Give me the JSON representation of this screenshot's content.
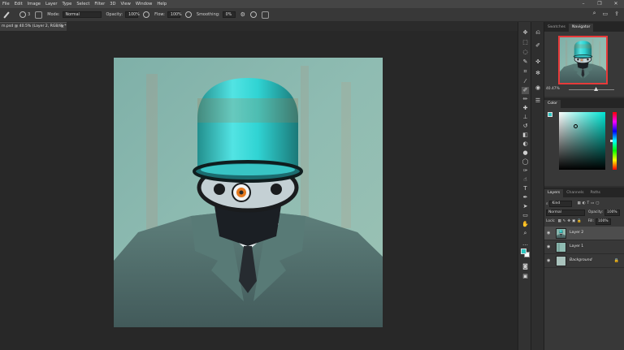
{
  "menu": [
    "File",
    "Edit",
    "Image",
    "Layer",
    "Type",
    "Select",
    "Filter",
    "3D",
    "View",
    "Window",
    "Help"
  ],
  "window_controls": [
    "–",
    "❐",
    "✕"
  ],
  "options": {
    "brush_size": "3",
    "mode_label": "Mode:",
    "mode_value": "Normal",
    "opacity_label": "Opacity:",
    "opacity_value": "100%",
    "flow_label": "Flow:",
    "flow_value": "100%",
    "smoothing_label": "Smoothing:",
    "smoothing_value": "0%"
  },
  "document_tab": {
    "title": "m.psd @ 40.5% (Layer 2, RGB/8) *",
    "close": "×"
  },
  "navigator": {
    "tabs": [
      "Swatches",
      "Navigator"
    ],
    "active_tab": "Navigator",
    "zoom": "40.47%",
    "zoom_level": 0.6
  },
  "color_panel": {
    "tab": "Color",
    "foreground": "#2fc7c2",
    "background": "#ffffff"
  },
  "layers_panel": {
    "tabs": [
      "Layers",
      "Channels",
      "Paths"
    ],
    "active_tab": "Layers",
    "filter_label": "Kind",
    "blend_mode": "Normal",
    "opacity_label": "Opacity:",
    "opacity_value": "100%",
    "lock_label": "Lock:",
    "fill_label": "Fill:",
    "fill_value": "100%",
    "layers": [
      {
        "name": "Layer 2",
        "active": true,
        "italic": false,
        "locked": false
      },
      {
        "name": "Layer 1",
        "active": false,
        "italic": false,
        "locked": false
      },
      {
        "name": "Background",
        "active": false,
        "italic": true,
        "locked": true
      }
    ]
  },
  "colors": {
    "accent_red": "#e63a3a",
    "cyan": "#2fc7c2"
  }
}
